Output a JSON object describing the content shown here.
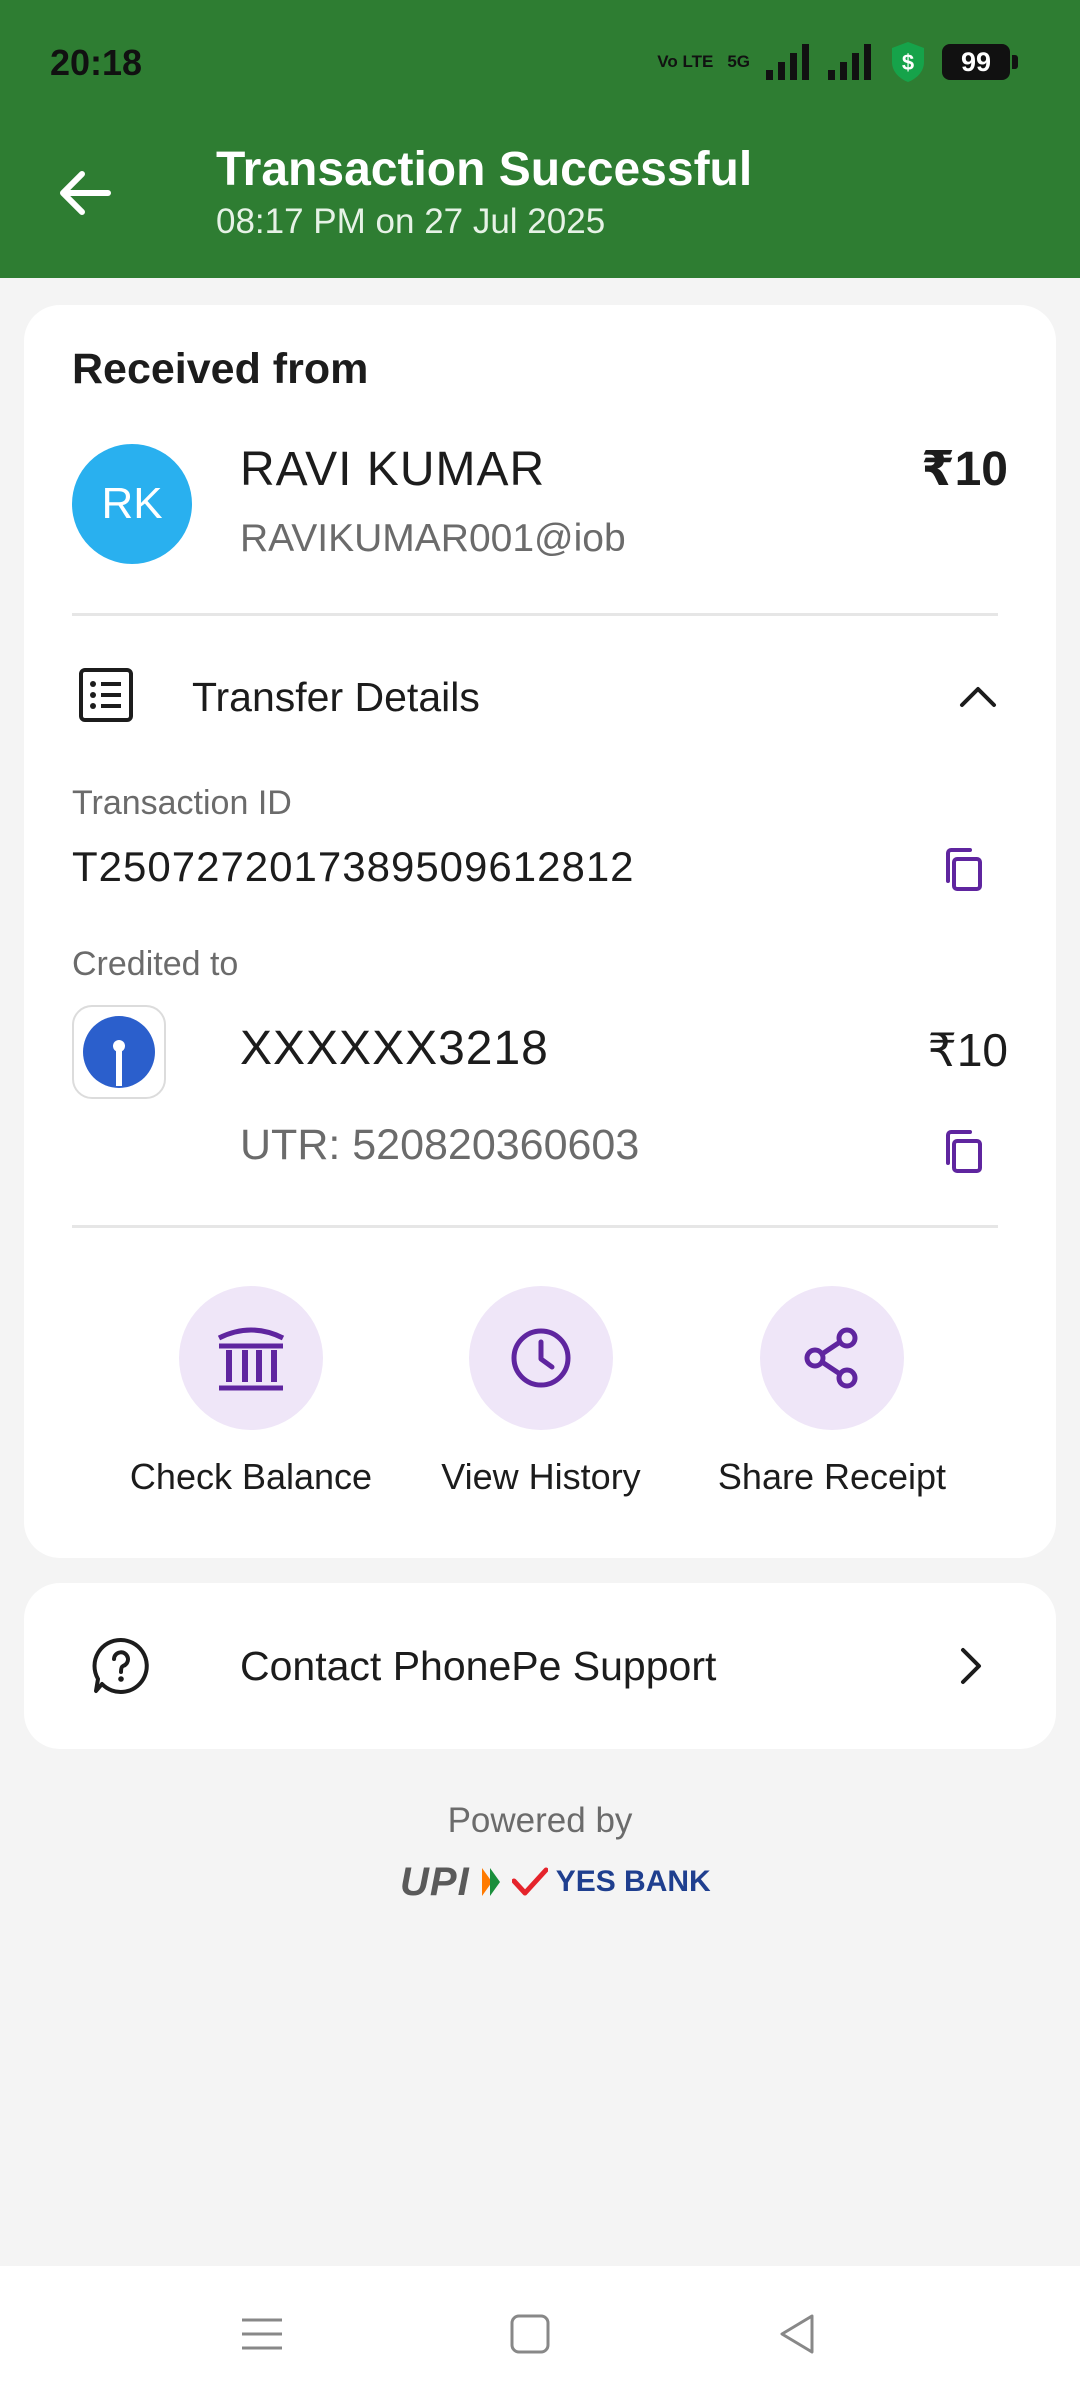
{
  "status_bar": {
    "time": "20:18",
    "network_line1": "Vo LTE",
    "network_line2": "5G",
    "battery": "99"
  },
  "header": {
    "title": "Transaction Successful",
    "subtitle": "08:17 PM on 27 Jul 2025",
    "background": "#2e7d32"
  },
  "received": {
    "label": "Received from",
    "initials": "RK",
    "name": "RAVI  KUMAR",
    "vpa": "RAVIKUMAR001@iob",
    "amount": "₹10"
  },
  "transfer": {
    "label": "Transfer Details",
    "txn_label": "Transaction ID",
    "txn_id": "T2507272017389509612812",
    "credited_label": "Credited to",
    "account": "XXXXXX3218",
    "account_amount": "₹10",
    "utr": "UTR: 520820360603"
  },
  "actions": [
    {
      "label": "Check Balance",
      "icon": "bank-icon"
    },
    {
      "label": "View History",
      "icon": "clock-icon"
    },
    {
      "label": "Share Receipt",
      "icon": "share-icon"
    }
  ],
  "support": {
    "label": "Contact PhonePe Support"
  },
  "footer": {
    "powered": "Powered by",
    "upi": "UPI",
    "bank": "YES BANK"
  },
  "accent_color": "#5f259f"
}
